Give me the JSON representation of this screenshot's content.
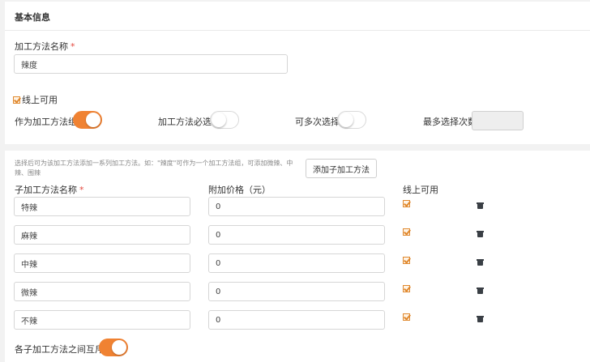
{
  "basic_info": {
    "title": "基本信息",
    "method_name_label": "加工方法名称",
    "required_mark": "*",
    "method_name_value": "辣度",
    "online_available_label": "线上可用",
    "online_available_checked": true,
    "as_group_label": "作为加工方法组",
    "as_group_on": true,
    "required_label": "加工方法必选",
    "required_on": false,
    "multi_select_label": "可多次选择",
    "multi_select_on": false,
    "max_select_label": "最多选择次数",
    "max_select_value": ""
  },
  "sub_methods": {
    "hint": "选择后可为该加工方法添加一系列加工方法。如：\"辣度\"可作为一个加工方法组，可添加微辣、中辣、围辣",
    "add_button_label": "添加子加工方法",
    "col_name_label": "子加工方法名称",
    "required_mark": "*",
    "col_price_label": "附加价格（元）",
    "col_online_label": "线上可用",
    "rows": [
      {
        "name": "特辣",
        "price": "0",
        "online": true
      },
      {
        "name": "麻辣",
        "price": "0",
        "online": true
      },
      {
        "name": "中辣",
        "price": "0",
        "online": true
      },
      {
        "name": "微辣",
        "price": "0",
        "online": true
      },
      {
        "name": "不辣",
        "price": "0",
        "online": true
      }
    ],
    "mutual_exclusive_label": "各子加工方法之间互斥",
    "mutual_exclusive_on": true
  },
  "icons": {
    "checkbox": "checkbox-checked-icon",
    "delete": "trash-icon"
  },
  "colors": {
    "accent": "#f08232",
    "checkbox": "#e0882d",
    "required": "#e4473d"
  }
}
